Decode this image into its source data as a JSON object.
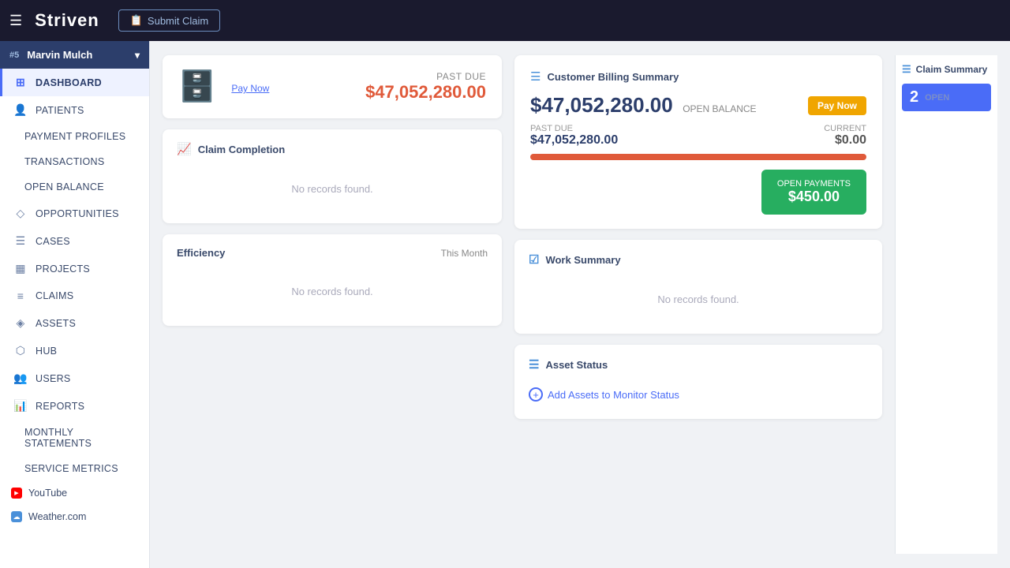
{
  "topbar": {
    "logo": "Striven",
    "submit_claim_label": "Submit Claim"
  },
  "sidebar": {
    "user": {
      "id": "#5",
      "name": "Marvin Mulch"
    },
    "items": [
      {
        "id": "dashboard",
        "label": "DASHBOARD",
        "icon": "⊞",
        "active": true
      },
      {
        "id": "patients",
        "label": "PATIENTS",
        "icon": "👤",
        "active": false
      },
      {
        "id": "payment-profiles",
        "label": "PAYMENT PROFILES",
        "icon": "",
        "active": false,
        "indent": true
      },
      {
        "id": "transactions",
        "label": "TRANSACTIONS",
        "icon": "",
        "active": false,
        "indent": true
      },
      {
        "id": "open-balance",
        "label": "OPEN BALANCE",
        "icon": "",
        "active": false,
        "indent": true
      },
      {
        "id": "opportunities",
        "label": "OPPORTUNITIES",
        "icon": "◇",
        "active": false
      },
      {
        "id": "cases",
        "label": "CASES",
        "icon": "☰",
        "active": false
      },
      {
        "id": "projects",
        "label": "PROJECTS",
        "icon": "▦",
        "active": false
      },
      {
        "id": "claims",
        "label": "CLAIMS",
        "icon": "≡",
        "active": false
      },
      {
        "id": "assets",
        "label": "ASSETS",
        "icon": "◈",
        "active": false
      },
      {
        "id": "hub",
        "label": "HUB",
        "icon": "⬡",
        "active": false
      },
      {
        "id": "users",
        "label": "USERS",
        "icon": "👥",
        "active": false
      },
      {
        "id": "reports",
        "label": "REPORTS",
        "icon": "📊",
        "active": false
      },
      {
        "id": "monthly-statements",
        "label": "MONTHLY STATEMENTS",
        "icon": "",
        "active": false,
        "indent": true
      },
      {
        "id": "service-metrics",
        "label": "SERVICE METRICS",
        "icon": "",
        "active": false,
        "indent": true
      }
    ],
    "external": [
      {
        "id": "youtube",
        "label": "YouTube",
        "type": "youtube"
      },
      {
        "id": "weather",
        "label": "Weather.com",
        "type": "weather"
      }
    ]
  },
  "past_due": {
    "label": "PAST DUE",
    "amount": "$47,052,280.00",
    "pay_now": "Pay Now"
  },
  "claim_completion": {
    "title": "Claim Completion",
    "no_records": "No records found."
  },
  "efficiency": {
    "title": "Efficiency",
    "period": "This Month",
    "no_records": "No records found."
  },
  "billing_summary": {
    "title": "Customer Billing Summary",
    "open_balance_amount": "$47,052,280.00",
    "open_balance_label": "OPEN BALANCE",
    "pay_now_label": "Pay Now",
    "past_due_label": "PAST DUE",
    "past_due_amount": "$47,052,280.00",
    "current_label": "CURRENT",
    "current_amount": "$0.00",
    "open_payments_label": "OPEN PAYMENTS",
    "open_payments_amount": "$450.00"
  },
  "work_summary": {
    "title": "Work Summary",
    "no_records": "No records found."
  },
  "asset_status": {
    "title": "Asset Status",
    "add_link": "Add Assets to Monitor Status"
  },
  "side_panel": {
    "title": "Claim Summary",
    "count": "2",
    "status": "OPEN"
  }
}
